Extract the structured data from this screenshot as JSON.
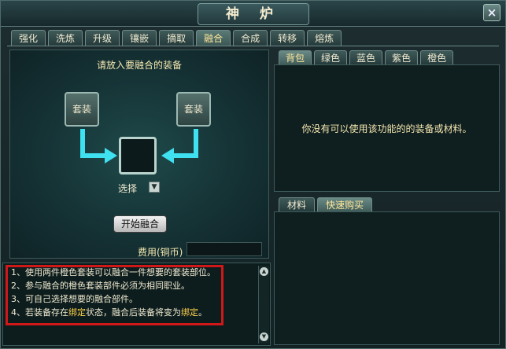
{
  "window": {
    "title": "神 炉",
    "close_icon": "close-icon"
  },
  "tabs": [
    "强化",
    "洗炼",
    "升级",
    "镶嵌",
    "摘取",
    "融合",
    "合成",
    "转移",
    "熔炼"
  ],
  "active_tab": "融合",
  "fusion": {
    "prompt": "请放入要融合的装备",
    "slot_left": "套装",
    "slot_right": "套装",
    "select_label": "选择",
    "start_button": "开始融合",
    "fee_label": "费用(铜币)",
    "fee_value": ""
  },
  "info": {
    "lines": [
      {
        "prefix": "1、使用两件橙色套装可以融合一件想要的套装部位。"
      },
      {
        "prefix": "2、参与融合的橙色套装部件必须为相同职业。"
      },
      {
        "prefix": "3、可自己选择想要的融合部件。"
      },
      {
        "prefix": "4、若装备存在",
        "hl1": "绑定",
        "mid": "状态，融合后装备将变为",
        "hl2": "绑定",
        "suffix": "。"
      }
    ],
    "highlight_color": "#d01818"
  },
  "right": {
    "tabs": [
      "背包",
      "绿色",
      "蓝色",
      "紫色",
      "橙色"
    ],
    "active_tab": "背包",
    "empty_message": "你没有可以使用该功能的的装备或材料。",
    "lower_tabs": [
      "材料",
      "快速购买"
    ],
    "lower_active_tab": "快速购买"
  }
}
